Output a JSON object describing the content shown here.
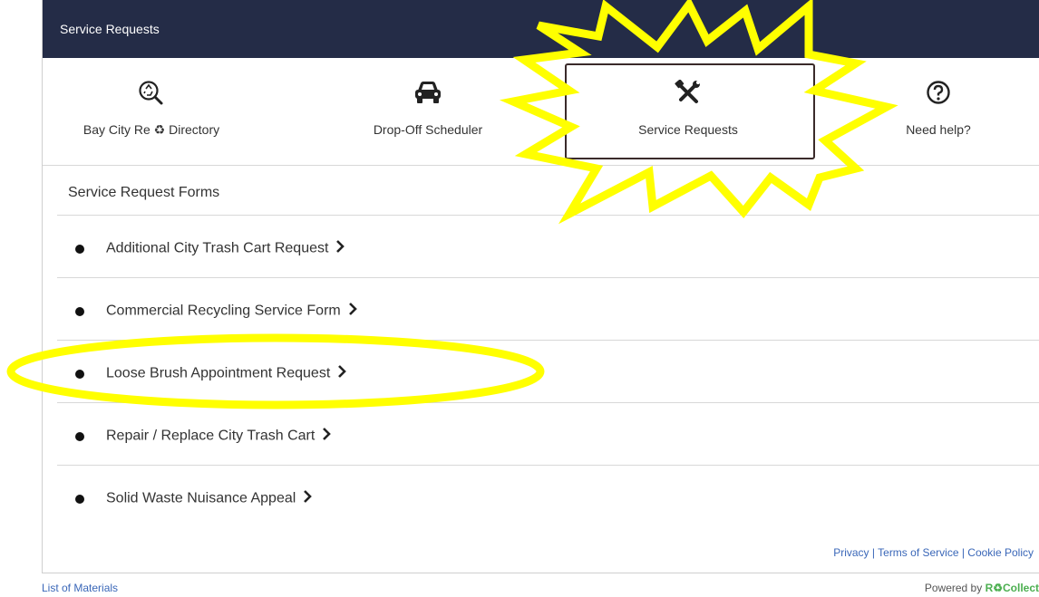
{
  "header": {
    "title": "Service Requests"
  },
  "nav": {
    "items": [
      {
        "label": "Bay City Re ♻ Directory",
        "icon": "recycle-search-icon"
      },
      {
        "label": "Drop-Off Scheduler",
        "icon": "car-icon"
      },
      {
        "label": "Service Requests",
        "icon": "tools-icon"
      },
      {
        "label": "Need help?",
        "icon": "question-circle-icon"
      }
    ]
  },
  "forms": {
    "title": "Service Request Forms",
    "items": [
      "Additional City Trash Cart Request",
      "Commercial Recycling Service Form",
      "Loose Brush Appointment Request",
      "Repair / Replace City Trash Cart",
      "Solid Waste Nuisance Appeal"
    ]
  },
  "footer": {
    "privacy": "Privacy",
    "sep1": " | ",
    "terms": "Terms of Service",
    "sep2": " | ",
    "cookie": "Cookie Policy",
    "list_of_materials": "List of Materials",
    "powered_by": "Powered by ",
    "brand": "R♻Collect"
  },
  "colors": {
    "header_bg": "#242c47",
    "highlight": "#ffff00",
    "link": "#3a67b8"
  }
}
